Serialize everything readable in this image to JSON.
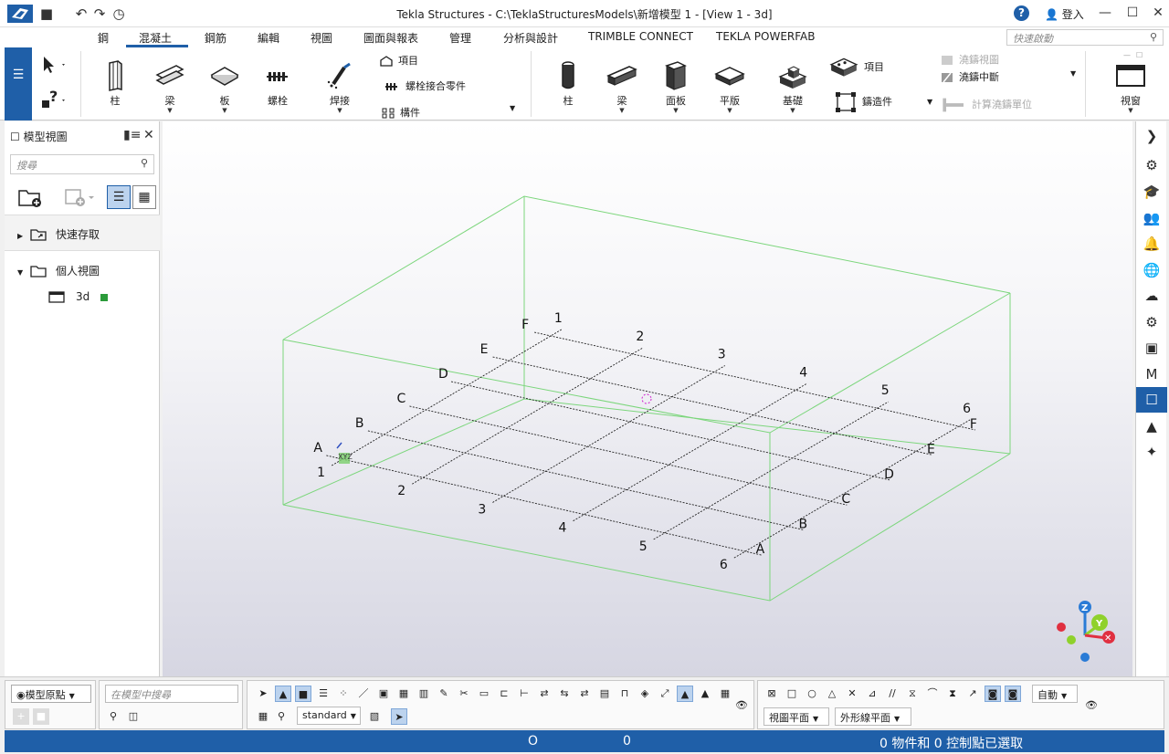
{
  "window": {
    "title": "Tekla Structures - C:\\TeklaStructuresModels\\新增模型 1 - [View 1 - 3d]",
    "help": "?",
    "login": "登入"
  },
  "tabs": [
    "鋼",
    "混凝土",
    "鋼筋",
    "編輯",
    "視圖",
    "圖面與報表",
    "管理",
    "分析與設計",
    "TRIMBLE CONNECT",
    "TEKLA POWERFAB"
  ],
  "active_tab": "混凝土",
  "quick_search_placeholder": "快速啟動",
  "ribbon": {
    "steel": {
      "column": "柱",
      "beam": "梁",
      "plate": "板",
      "bolt": "螺栓",
      "weld": "焊接",
      "item": "項目",
      "bolt_assembly": "螺栓接合零件",
      "component": "構件"
    },
    "concrete": {
      "column": "柱",
      "beam": "梁",
      "panel": "面板",
      "slab": "平版",
      "footing": "基礎",
      "item": "項目",
      "cast_unit": "鑄造件",
      "pour_view": "澆鑄視圖",
      "pour_break": "澆鑄中斷",
      "calc_pour_units": "計算澆鑄單位"
    },
    "window": "視窗"
  },
  "left_panel": {
    "title": "模型視圖",
    "search_placeholder": "搜尋",
    "quick_access": "快速存取",
    "personal_views": "個人視圖",
    "view_item": "3d"
  },
  "grid": {
    "letters": [
      "A",
      "B",
      "C",
      "D",
      "E",
      "F"
    ],
    "numbers": [
      "1",
      "2",
      "3",
      "4",
      "5",
      "6"
    ]
  },
  "axis": {
    "z": "Z",
    "y": "Y",
    "x": "✕"
  },
  "colors": {
    "accent": "#1f5fa8",
    "workarea": "#7cd67c",
    "view_marker": "#2b9b3a"
  },
  "bottom": {
    "origin": "模型原點",
    "model_search_placeholder": "在模型中搜尋",
    "standard": "standard",
    "auto": "自動",
    "view_plane": "視圖平面",
    "outline_plane": "外形線平面"
  },
  "status": {
    "o_label": "O",
    "zero": "0",
    "selection": "0 物件和 0 控制點已選取"
  }
}
